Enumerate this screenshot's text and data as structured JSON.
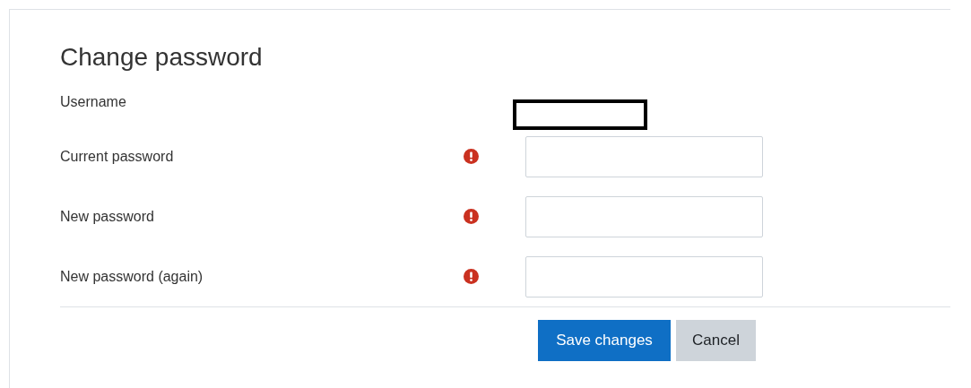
{
  "title": "Change password",
  "fields": [
    {
      "label": "Username",
      "kind": "static",
      "required": false
    },
    {
      "label": "Current password",
      "kind": "password",
      "required": true
    },
    {
      "label": "New password",
      "kind": "password",
      "required": true
    },
    {
      "label": "New password (again)",
      "kind": "password",
      "required": true
    }
  ],
  "buttons": [
    {
      "label": "Save changes",
      "kind": "primary"
    },
    {
      "label": "Cancel",
      "kind": "secondary"
    }
  ]
}
